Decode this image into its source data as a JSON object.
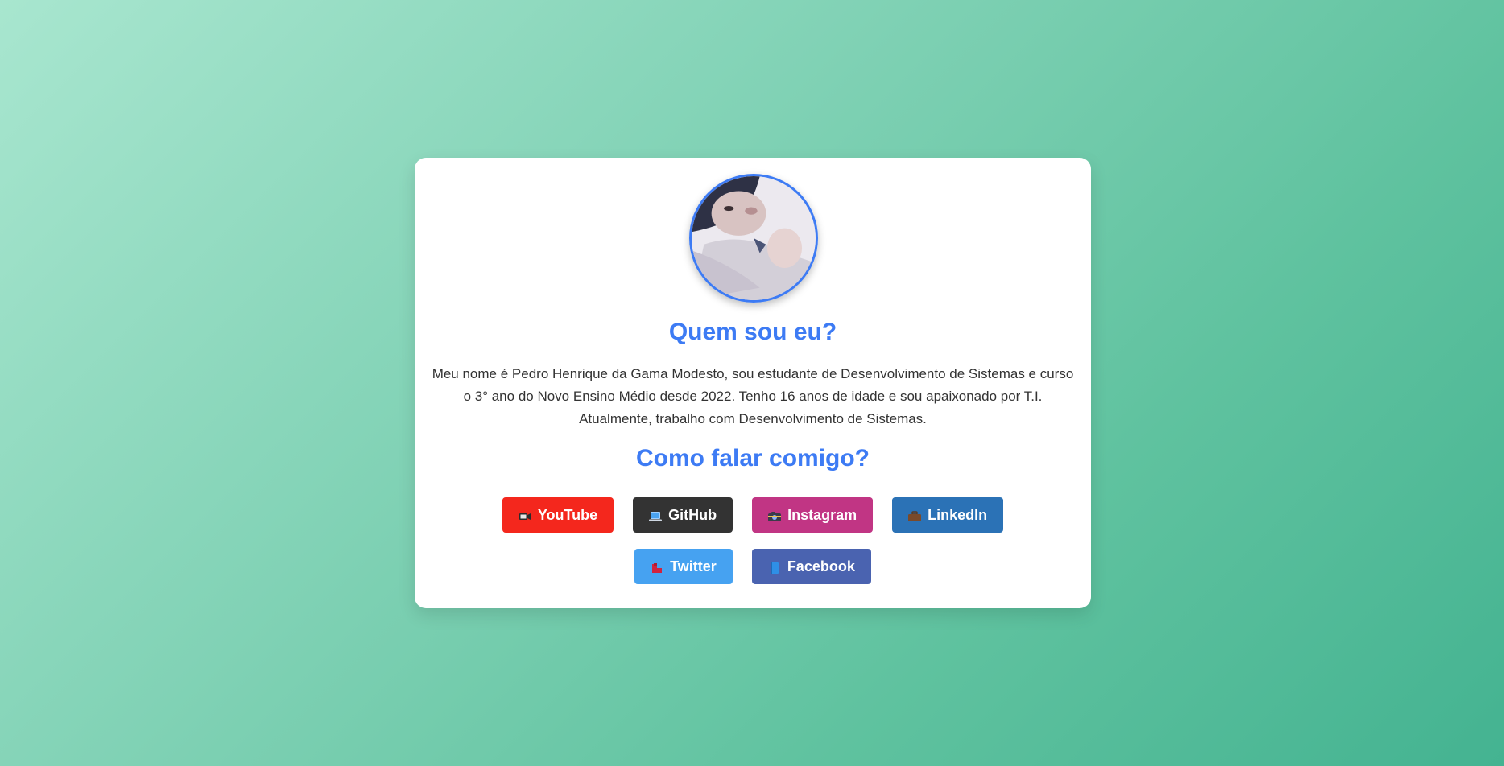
{
  "profile": {
    "avatar_alt": "baby photo",
    "heading_who": "Quem sou eu?",
    "bio": "Meu nome é Pedro Henrique da Gama Modesto, sou estudante de Desenvolvimento de Sistemas e curso o 3° ano do Novo Ensino Médio desde 2022. Tenho 16 anos de idade e sou apaixonado por T.I. Atualmente, trabalho com Desenvolvimento de Sistemas.",
    "heading_contact": "Como falar comigo?"
  },
  "links": [
    {
      "label": "YouTube",
      "icon": "video-camera-icon",
      "color": "#f4271d"
    },
    {
      "label": "GitHub",
      "icon": "laptop-icon",
      "color": "#333333"
    },
    {
      "label": "Instagram",
      "icon": "camera-icon",
      "color": "#c13584"
    },
    {
      "label": "LinkedIn",
      "icon": "briefcase-icon",
      "color": "#2b72b6"
    },
    {
      "label": "Twitter",
      "icon": "bird-icon",
      "color": "#46a2f1"
    },
    {
      "label": "Facebook",
      "icon": "book-icon",
      "color": "#4a63b0"
    }
  ],
  "colors": {
    "accent": "#3d7bf4",
    "background_start": "#a8e6cf",
    "background_end": "#44b391"
  }
}
